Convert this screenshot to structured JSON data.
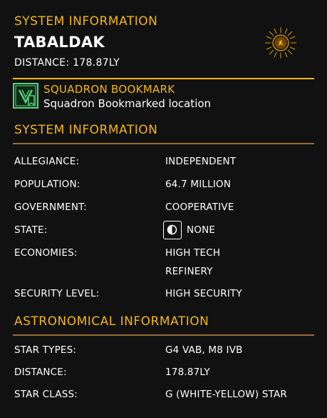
{
  "header": {
    "section_title": "SYSTEM INFORMATION",
    "system_name": "TABALDAK",
    "distance": "DISTANCE: 178.87LY"
  },
  "bookmark": {
    "title": "SQUADRON BOOKMARK",
    "description": "Squadron Bookmarked location"
  },
  "system_info": {
    "title": "SYSTEM INFORMATION",
    "rows": [
      {
        "label": "ALLEGIANCE:",
        "value": "INDEPENDENT"
      },
      {
        "label": "POPULATION:",
        "value": "64.7 MILLION"
      },
      {
        "label": "GOVERNMENT:",
        "value": "COOPERATIVE"
      },
      {
        "label": "STATE:",
        "value": "NONE"
      },
      {
        "label": "ECONOMIES:",
        "values": [
          "HIGH TECH",
          "REFINERY"
        ]
      },
      {
        "label": "SECURITY LEVEL:",
        "value": "HIGH SECURITY"
      }
    ]
  },
  "astronomical_info": {
    "title": "ASTRONOMICAL INFORMATION",
    "rows": [
      {
        "label": "STAR TYPES:",
        "value": "G4 VAB, M8 IVB"
      },
      {
        "label": "DISTANCE:",
        "value": "178.87LY"
      },
      {
        "label": "STAR CLASS:",
        "value": "G (WHITE-YELLOW) STAR"
      }
    ]
  },
  "icons": {
    "star": "star-sun-icon",
    "bookmark": "squadron-bookmark-icon",
    "state": "state-half-circle-icon"
  },
  "colors": {
    "accent": "#f5b70f",
    "divider_brown": "#9a6a36",
    "bookmark_green": "#5ccf7a",
    "background": "#111111"
  }
}
